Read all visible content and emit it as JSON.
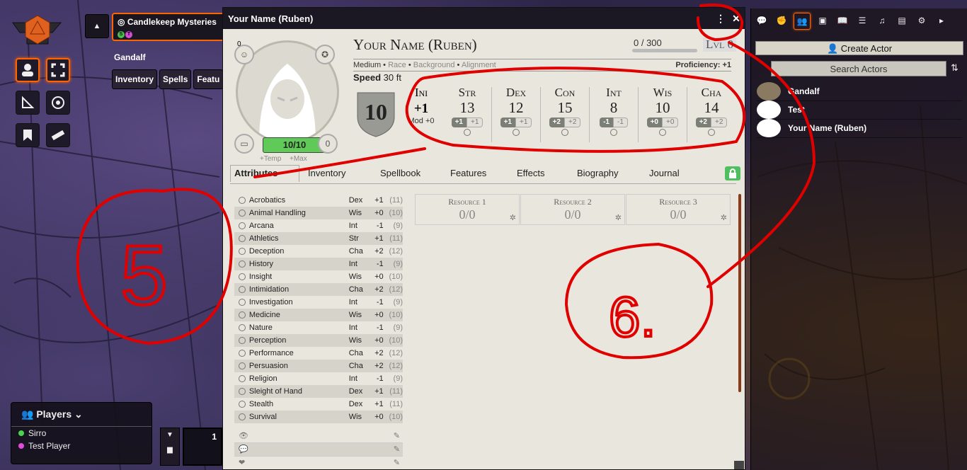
{
  "scene": {
    "name": "Candlekeep Mysteries",
    "badges": [
      "S",
      "T"
    ],
    "colors": {
      "S": "#4cc04c",
      "T": "#d44cd4"
    }
  },
  "token": {
    "name": "Gandalf",
    "tabs": [
      "Inventory",
      "Spells",
      "Featu"
    ]
  },
  "players": {
    "title": "Players",
    "list": [
      {
        "name": "Sirro",
        "color": "#4cd34c"
      },
      {
        "name": "Test Player",
        "color": "#e04cd8"
      }
    ]
  },
  "hotbar": {
    "slot_number": "1"
  },
  "sheet": {
    "window_title": "Your Name (Ruben)",
    "name": "Your Name (Ruben)",
    "xp": "0 / 300",
    "level": "Lvl 0",
    "size": "Medium",
    "race": "Race",
    "background": "Background",
    "alignment": "Alignment",
    "proficiency": "Proficiency: +1",
    "speed_label": "Speed",
    "speed_value": "30 ft",
    "hp": "10/10",
    "hp_temp": "+Temp",
    "hp_max": "+Max",
    "death": "0",
    "top_left_badge": "0",
    "ac": "10",
    "initiative": {
      "label": "Ini",
      "value": "+1",
      "mod": "Mod +0"
    },
    "abilities": [
      {
        "label": "Str",
        "score": "13",
        "mod": "+1",
        "save": "+1"
      },
      {
        "label": "Dex",
        "score": "12",
        "mod": "+1",
        "save": "+1"
      },
      {
        "label": "Con",
        "score": "15",
        "mod": "+2",
        "save": "+2"
      },
      {
        "label": "Int",
        "score": "8",
        "mod": "-1",
        "save": "-1"
      },
      {
        "label": "Wis",
        "score": "10",
        "mod": "+0",
        "save": "+0"
      },
      {
        "label": "Cha",
        "score": "14",
        "mod": "+2",
        "save": "+2"
      }
    ],
    "tabs": [
      "Attributes",
      "Inventory",
      "Spellbook",
      "Features",
      "Effects",
      "Biography",
      "Journal"
    ],
    "skills": [
      {
        "name": "Acrobatics",
        "ability": "Dex",
        "mod": "+1",
        "passive": "(11)"
      },
      {
        "name": "Animal Handling",
        "ability": "Wis",
        "mod": "+0",
        "passive": "(10)"
      },
      {
        "name": "Arcana",
        "ability": "Int",
        "mod": "-1",
        "passive": "(9)"
      },
      {
        "name": "Athletics",
        "ability": "Str",
        "mod": "+1",
        "passive": "(11)"
      },
      {
        "name": "Deception",
        "ability": "Cha",
        "mod": "+2",
        "passive": "(12)"
      },
      {
        "name": "History",
        "ability": "Int",
        "mod": "-1",
        "passive": "(9)"
      },
      {
        "name": "Insight",
        "ability": "Wis",
        "mod": "+0",
        "passive": "(10)"
      },
      {
        "name": "Intimidation",
        "ability": "Cha",
        "mod": "+2",
        "passive": "(12)"
      },
      {
        "name": "Investigation",
        "ability": "Int",
        "mod": "-1",
        "passive": "(9)"
      },
      {
        "name": "Medicine",
        "ability": "Wis",
        "mod": "+0",
        "passive": "(10)"
      },
      {
        "name": "Nature",
        "ability": "Int",
        "mod": "-1",
        "passive": "(9)"
      },
      {
        "name": "Perception",
        "ability": "Wis",
        "mod": "+0",
        "passive": "(10)"
      },
      {
        "name": "Performance",
        "ability": "Cha",
        "mod": "+2",
        "passive": "(12)"
      },
      {
        "name": "Persuasion",
        "ability": "Cha",
        "mod": "+2",
        "passive": "(12)"
      },
      {
        "name": "Religion",
        "ability": "Int",
        "mod": "-1",
        "passive": "(9)"
      },
      {
        "name": "Sleight of Hand",
        "ability": "Dex",
        "mod": "+1",
        "passive": "(11)"
      },
      {
        "name": "Stealth",
        "ability": "Dex",
        "mod": "+1",
        "passive": "(11)"
      },
      {
        "name": "Survival",
        "ability": "Wis",
        "mod": "+0",
        "passive": "(10)"
      }
    ],
    "resources": [
      {
        "label": "Resource 1",
        "value": "0/0"
      },
      {
        "label": "Resource 2",
        "value": "0/0"
      },
      {
        "label": "Resource 3",
        "value": "0/0"
      }
    ]
  },
  "sidebar": {
    "create_actor": "Create Actor",
    "search_placeholder": "Search Actors",
    "actors": [
      "Gandalf",
      "Test",
      "Your Name (Ruben)"
    ]
  },
  "annotations": [
    "5",
    "6."
  ]
}
